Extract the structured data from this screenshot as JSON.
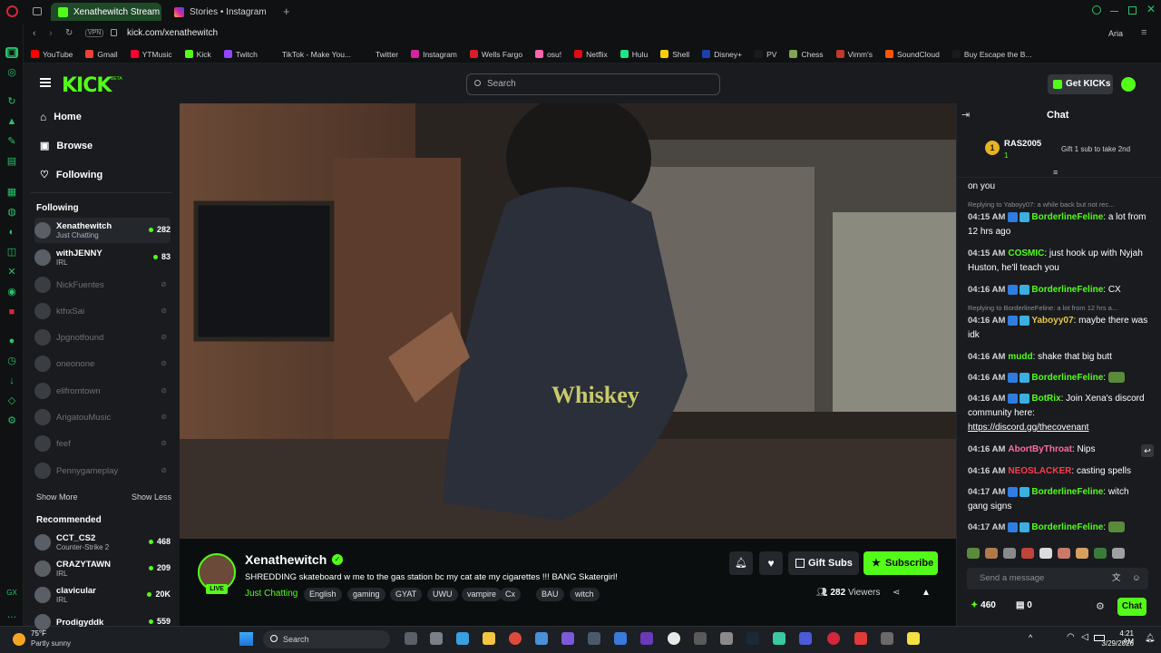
{
  "browser": {
    "tabs": [
      {
        "label": "Xenathewitch Stream - W",
        "active": true
      },
      {
        "label": "Stories • Instagram",
        "active": false
      }
    ],
    "url": "kick.com/xenathewitch",
    "vpn_label": "VPN",
    "aria_label": "Aria",
    "bookmarks": [
      "YouTube",
      "Gmail",
      "YTMusic",
      "Kick",
      "Twitch",
      "TikTok - Make You...",
      "Twitter",
      "Instagram",
      "Wells Fargo",
      "osu!",
      "Netflix",
      "Hulu",
      "Shell",
      "Disney+",
      "PV",
      "Chess",
      "Vimm's",
      "SoundCloud",
      "Buy Escape the B..."
    ]
  },
  "header": {
    "logo": "KICK",
    "logo_sup": "BETA",
    "search_placeholder": "Search",
    "get_kicks_label": "Get KICKs"
  },
  "sidebar": {
    "nav": [
      {
        "label": "Home",
        "icon": "home-icon"
      },
      {
        "label": "Browse",
        "icon": "browse-icon"
      },
      {
        "label": "Following",
        "icon": "heart-icon"
      }
    ],
    "following_title": "Following",
    "following": [
      {
        "name": "Xenathewitch",
        "sub": "Just Chatting",
        "count": "282",
        "live": true
      },
      {
        "name": "withJENNY",
        "sub": "IRL",
        "count": "83",
        "live": true
      },
      {
        "name": "NickFuentes",
        "live": false
      },
      {
        "name": "kthxSai",
        "live": false
      },
      {
        "name": "Jpgnotfound",
        "live": false
      },
      {
        "name": "oneonone",
        "live": false
      },
      {
        "name": "elifromtown",
        "live": false
      },
      {
        "name": "ArigatouMusic",
        "live": false
      },
      {
        "name": "feef",
        "live": false
      },
      {
        "name": "Pennygameplay",
        "live": false
      }
    ],
    "show_more": "Show More",
    "show_less": "Show Less",
    "recommended_title": "Recommended",
    "recommended": [
      {
        "name": "CCT_CS2",
        "sub": "Counter-Strike 2",
        "count": "468"
      },
      {
        "name": "CRAZYTAWN",
        "sub": "IRL",
        "count": "209"
      },
      {
        "name": "clavicular",
        "sub": "IRL",
        "count": "20K"
      },
      {
        "name": "Prodigyddk",
        "sub": "",
        "count": "559"
      }
    ]
  },
  "stream": {
    "channel": "Xenathewitch",
    "title": "SHREDDING skateboard w me to the gas station bc my cat ate my cigarettes !!! BANG Skatergirl!",
    "category": "Just Chatting",
    "tags": [
      "English",
      "gaming",
      "GYAT",
      "UWU",
      "vampire",
      "Cx",
      "BAU",
      "witch"
    ],
    "live_badge": "LIVE",
    "gift_subs_label": "Gift Subs",
    "subscribe_label": "Subscribe",
    "viewers": "282",
    "viewers_label": "Viewers"
  },
  "chat": {
    "title": "Chat",
    "pinned_user": "RAS2005",
    "pinned_level": "1",
    "pinned_count": "1",
    "gift_promo": "Gift 1 sub to take 2nd",
    "carryover": "on you",
    "messages": [
      {
        "reply": "Replying to Yaboyy07: a while back but not rec...",
        "time": "04:15 AM",
        "user": "BorderlineFeline",
        "color": "#53fc18",
        "text": "a lot from 12 hrs ago"
      },
      {
        "time": "04:15 AM",
        "user": "COSMIC",
        "color": "#53fc18",
        "text": "just hook up with Nyjah Huston, he'll teach you"
      },
      {
        "time": "04:16 AM",
        "user": "BorderlineFeline",
        "color": "#53fc18",
        "text": "CX"
      },
      {
        "reply": "Replying to BorderlineFeline: a lot from 12 hrs a...",
        "time": "04:16 AM",
        "user": "Yaboyy07",
        "color": "#e6c84a",
        "text": "maybe there was idk"
      },
      {
        "time": "04:16 AM",
        "user": "mudd",
        "color": "#53fc18",
        "text": "shake that big butt"
      },
      {
        "time": "04:16 AM",
        "user": "BorderlineFeline",
        "color": "#53fc18",
        "text": ""
      },
      {
        "time": "04:16 AM",
        "user": "BotRix",
        "color": "#53fc18",
        "text": "Join Xena's discord community here:",
        "link": "https://discord.gg/thecovenant"
      },
      {
        "time": "04:16 AM",
        "user": "AbortByThroat",
        "color": "#ff6b9a",
        "text": "Nips"
      },
      {
        "time": "04:16 AM",
        "user": "NEOSLACKER",
        "color": "#ff3b4a",
        "text": "casting spells"
      },
      {
        "time": "04:17 AM",
        "user": "BorderlineFeline",
        "color": "#53fc18",
        "text": "witch gang signs"
      },
      {
        "time": "04:17 AM",
        "user": "BorderlineFeline",
        "color": "#53fc18",
        "text": ""
      }
    ],
    "input_placeholder": "Send a message",
    "points": "460",
    "gifts": "0",
    "chat_button": "Chat"
  },
  "taskbar": {
    "weather_temp": "75°F",
    "weather_desc": "Partly sunny",
    "search_label": "Search",
    "time": "4:21 AM",
    "date": "3/29/2026"
  },
  "colors": {
    "brand": "#53fc18",
    "bg": "#0b0e0f",
    "panel": "#191b1f"
  }
}
